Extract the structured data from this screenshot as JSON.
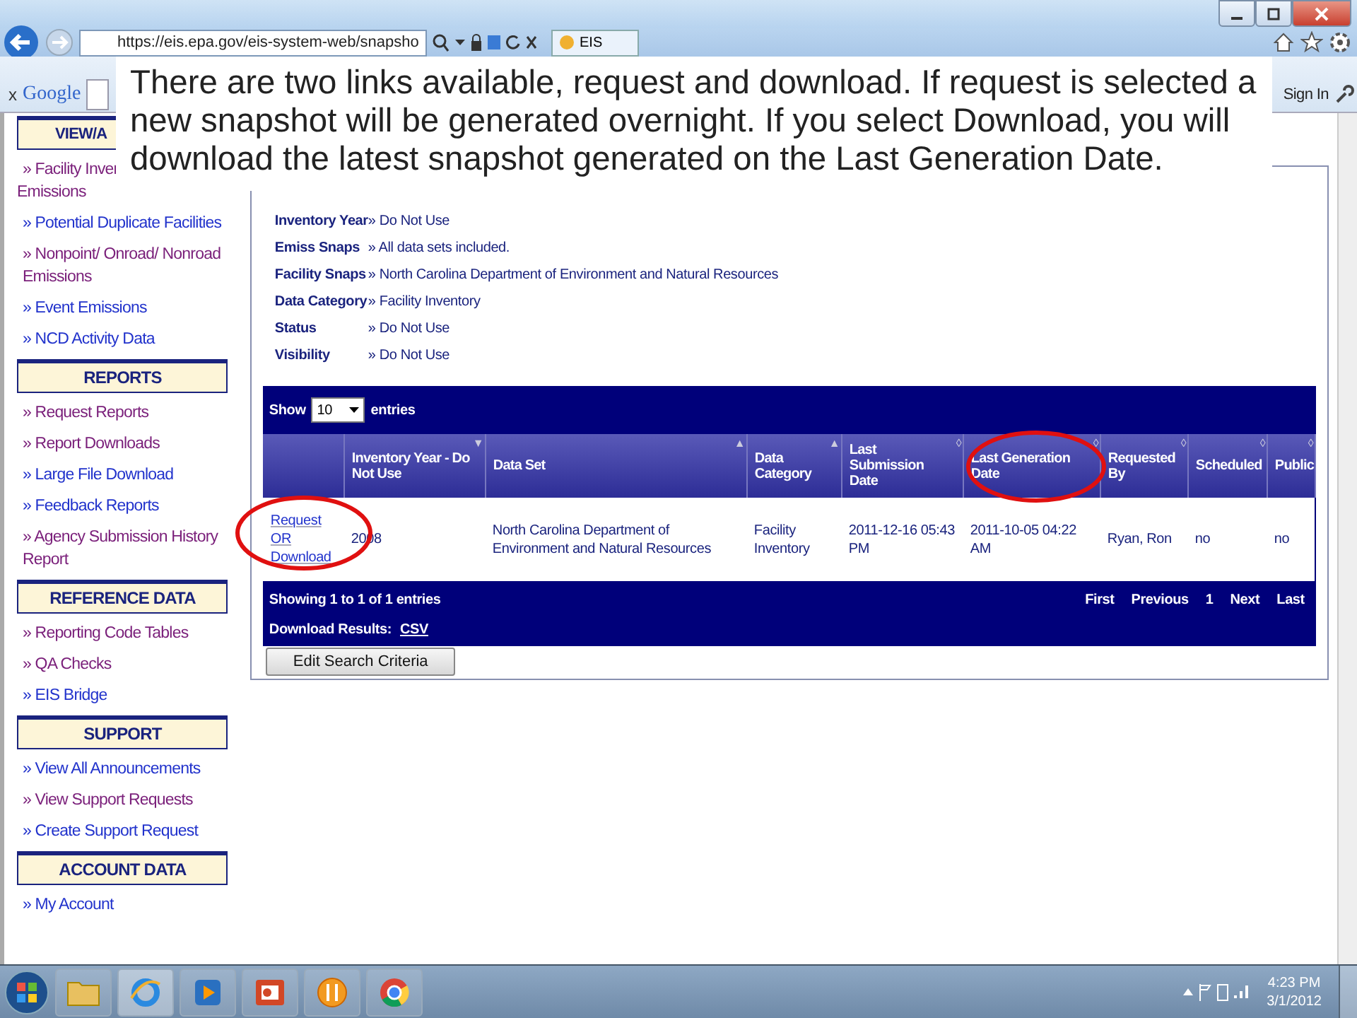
{
  "browser": {
    "address": "https://eis.epa.gov/eis-system-web/snapsho",
    "tab_title": "EIS",
    "toolbar_close": "x",
    "search_brand": "Google",
    "sign_in": "Sign In"
  },
  "callout": "There are two links available, request and download. If request is selected a new snapshot will be generated overnight. If you select Download, you will download the latest snapshot generated on the Last Generation Date.",
  "sidebar": [
    {
      "kind": "heading",
      "label": "VIEW/A"
    },
    {
      "kind": "link",
      "label": "» Facility Inver",
      "second_line": "Emissions",
      "visited": true
    },
    {
      "kind": "link",
      "label": "» Potential Duplicate Facilities",
      "visited": false
    },
    {
      "kind": "link",
      "label": "» Nonpoint/ Onroad/ Nonroad Emissions",
      "visited": true
    },
    {
      "kind": "link",
      "label": "» Event Emissions",
      "visited": false
    },
    {
      "kind": "link",
      "label": "» NCD Activity Data",
      "visited": false
    },
    {
      "kind": "heading",
      "label": "REPORTS"
    },
    {
      "kind": "link",
      "label": "» Request Reports",
      "visited": true
    },
    {
      "kind": "link",
      "label": "» Report Downloads",
      "visited": true
    },
    {
      "kind": "link",
      "label": "» Large File Download",
      "visited": false
    },
    {
      "kind": "link",
      "label": "» Feedback Reports",
      "visited": false
    },
    {
      "kind": "link",
      "label": "» Agency Submission History Report",
      "visited": true
    },
    {
      "kind": "heading",
      "label": "REFERENCE DATA"
    },
    {
      "kind": "link",
      "label": "» Reporting Code Tables",
      "visited": true
    },
    {
      "kind": "link",
      "label": "» QA Checks",
      "visited": true
    },
    {
      "kind": "link",
      "label": "» EIS Bridge",
      "visited": false
    },
    {
      "kind": "heading",
      "label": "SUPPORT"
    },
    {
      "kind": "link",
      "label": "» View All Announcements",
      "visited": false
    },
    {
      "kind": "link",
      "label": "» View Support Requests",
      "visited": true
    },
    {
      "kind": "link",
      "label": "» Create Support Request",
      "visited": false
    },
    {
      "kind": "heading",
      "label": "ACCOUNT DATA"
    },
    {
      "kind": "link",
      "label": "» My Account",
      "visited": false
    }
  ],
  "criteria": [
    {
      "label": "Inventory Year",
      "value": "» Do Not Use"
    },
    {
      "label": "Emiss Snaps",
      "value": "» All data sets included."
    },
    {
      "label": "Facility Snaps",
      "value": "» North Carolina Department of Environment and Natural Resources"
    },
    {
      "label": "Data Category",
      "value": "» Facility Inventory"
    },
    {
      "label": "Status",
      "value": "» Do Not Use"
    },
    {
      "label": "Visibility",
      "value": "» Do Not Use"
    }
  ],
  "table": {
    "show_label": "Show",
    "page_size": "10",
    "entries_label": "entries",
    "columns": [
      {},
      {
        "label": "Inventory Year - Do Not Use",
        "sort_icon": "▼"
      },
      {
        "label": "Data Set",
        "sort_icon": "▲"
      },
      {
        "label": "Data Category",
        "sort_icon": "▲"
      },
      {
        "label": "Last Submission Date",
        "sort_icon": "◊"
      },
      {
        "label": "Last Generation Date",
        "sort_icon": "◊"
      },
      {
        "label": "Requested By",
        "sort_icon": "◊"
      },
      {
        "label": "Scheduled",
        "sort_icon": "◊"
      },
      {
        "label": "Public",
        "sort_icon": "◊"
      }
    ],
    "rows": [
      {
        "cells": [
          [
            "Request",
            "OR",
            "Download"
          ],
          "2008",
          "North Carolina Department of Environment and Natural Resources",
          "Facility Inventory",
          "2011-12-16 05:43 PM",
          "2011-10-05 04:22 AM",
          "Ryan, Ron",
          "no",
          "no"
        ]
      }
    ],
    "info": "Showing 1 to 1 of 1 entries",
    "pagination": [
      "First",
      "Previous",
      "1",
      "Next",
      "Last"
    ],
    "download_label": "Download Results:",
    "download_link": "CSV"
  },
  "edit_button": "Edit Search Criteria",
  "taskbar": {
    "time": "4:23 PM",
    "date": "3/1/2012"
  }
}
